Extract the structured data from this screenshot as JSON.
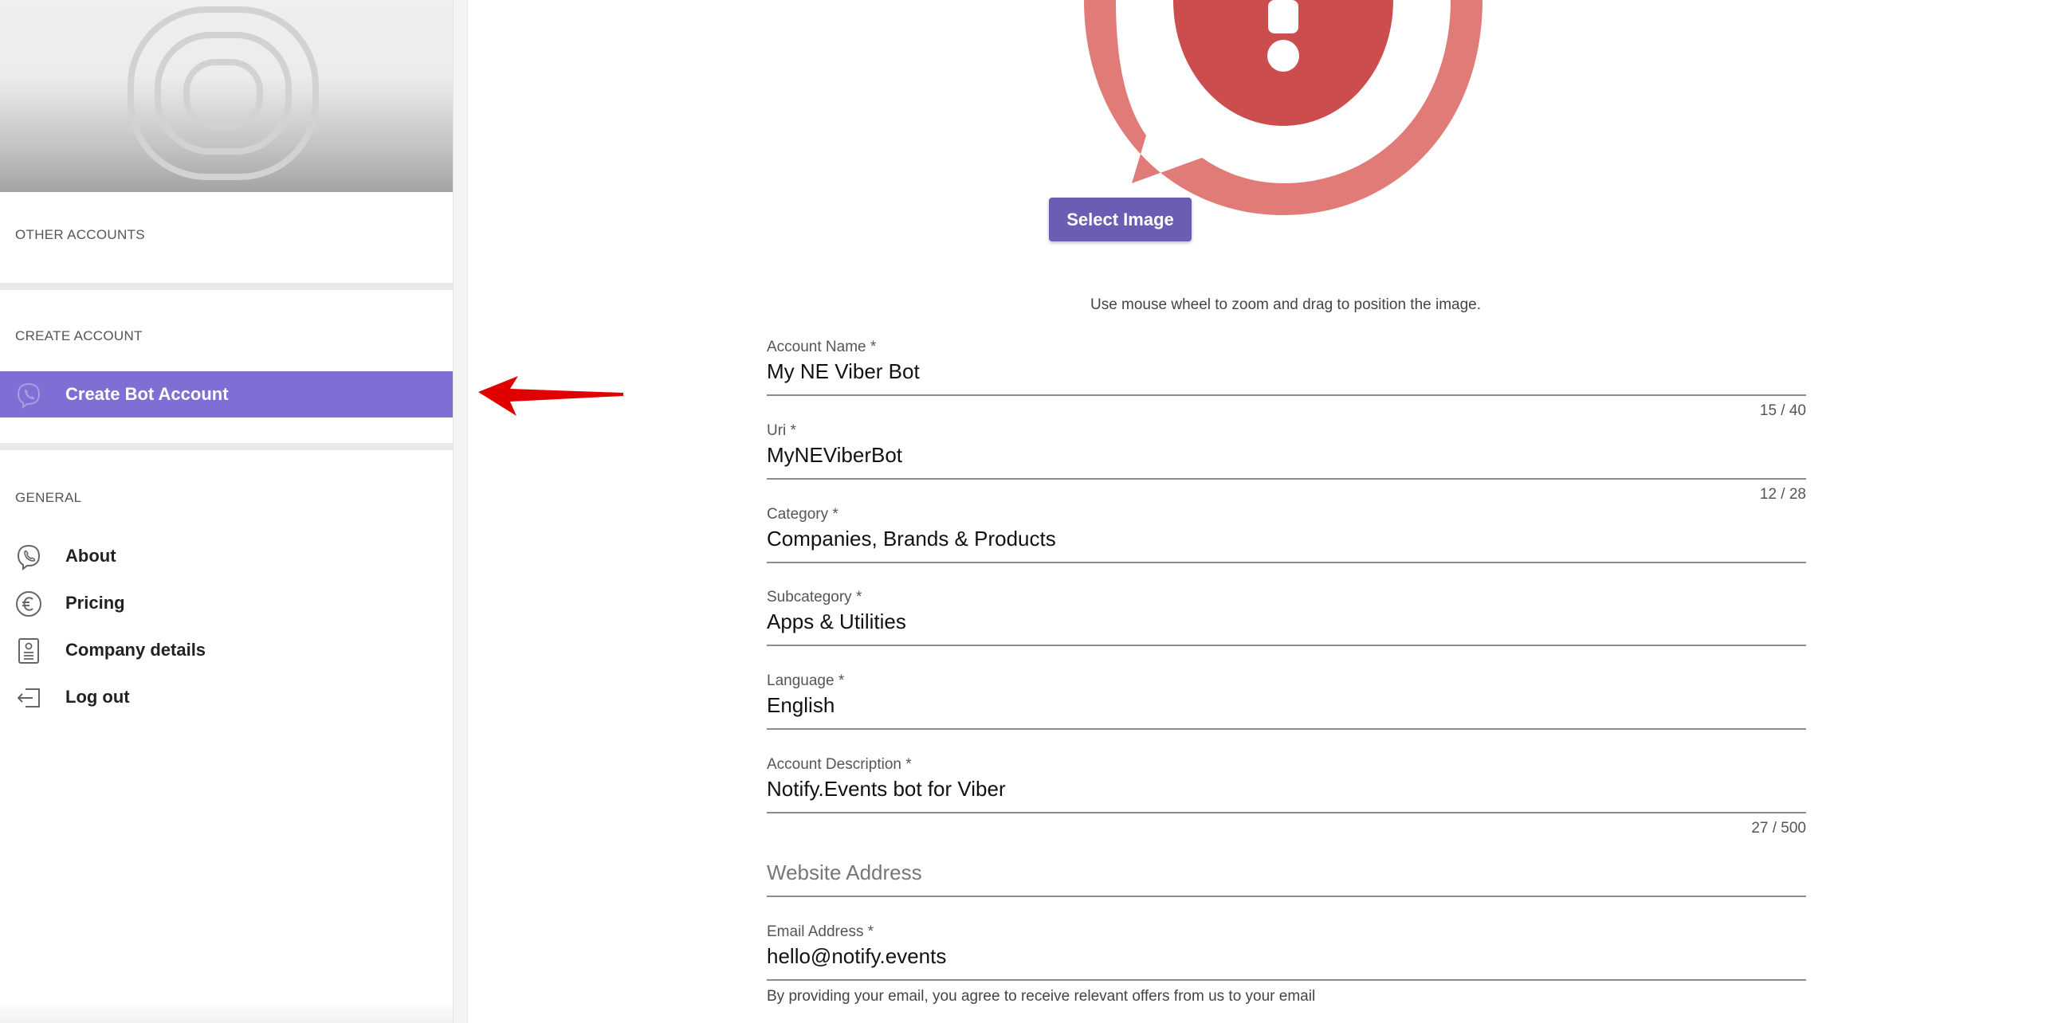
{
  "sidebar": {
    "other_accounts_label": "OTHER ACCOUNTS",
    "create_account_label": "CREATE ACCOUNT",
    "create_bot_label": "Create Bot Account",
    "general_label": "GENERAL",
    "items": [
      {
        "label": "About",
        "icon": "viber-phone-icon"
      },
      {
        "label": "Pricing",
        "icon": "euro-icon"
      },
      {
        "label": "Company details",
        "icon": "company-document-icon"
      },
      {
        "label": "Log out",
        "icon": "logout-icon"
      }
    ],
    "active_color": "#7e6fd4"
  },
  "main": {
    "select_image_label": "Select Image",
    "hint": "Use mouse wheel to zoom and drag to position the image.",
    "fields": {
      "account_name": {
        "label": "Account Name *",
        "value": "My NE Viber Bot",
        "count": "15 / 40"
      },
      "uri": {
        "label": "Uri *",
        "value": "MyNEViberBot",
        "count": "12 / 28"
      },
      "category": {
        "label": "Category *",
        "value": "Companies, Brands & Products"
      },
      "subcategory": {
        "label": "Subcategory *",
        "value": "Apps & Utilities"
      },
      "language": {
        "label": "Language *",
        "value": "English"
      },
      "description": {
        "label": "Account Description *",
        "value": "Notify.Events bot for Viber",
        "count": "27 / 500"
      },
      "website": {
        "placeholder": "Website Address"
      },
      "email": {
        "label": "Email Address *",
        "value": "hello@notify.events"
      }
    },
    "consent": "By providing your email, you agree to receive relevant offers from us to your email",
    "button_color": "#6a5db3",
    "accent_red": "#cc4d4d"
  }
}
